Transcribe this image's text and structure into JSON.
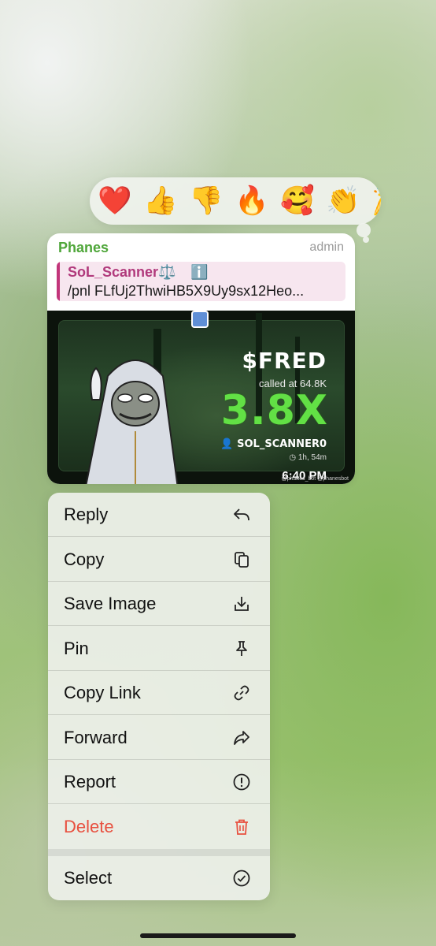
{
  "reactions": [
    "❤️",
    "👍",
    "👎",
    "🔥",
    "🥰",
    "👏",
    "🎉"
  ],
  "message": {
    "sender": "Phanes",
    "role": "admin",
    "quote": {
      "name": "SoL_Scanner⚖️",
      "name_icon": "ℹ️",
      "text": "/pnl FLfUj2ThwiHB5X9Uy9sx12Heo..."
    },
    "card": {
      "ticker": "$FRED",
      "called_at": "called at 64.8K",
      "multiple": "3.8X",
      "caller": "SOL_SCANNER0",
      "duration": "1h, 54m",
      "time": "6:40 PM",
      "handles": "@phanes_bot   @phanesbot"
    }
  },
  "menu": {
    "items": [
      {
        "label": "Reply",
        "icon": "reply-icon"
      },
      {
        "label": "Copy",
        "icon": "copy-icon"
      },
      {
        "label": "Save Image",
        "icon": "save-image-icon"
      },
      {
        "label": "Pin",
        "icon": "pin-icon"
      },
      {
        "label": "Copy Link",
        "icon": "link-icon"
      },
      {
        "label": "Forward",
        "icon": "forward-icon"
      },
      {
        "label": "Report",
        "icon": "report-icon"
      },
      {
        "label": "Delete",
        "icon": "trash-icon"
      },
      {
        "label": "Select",
        "icon": "select-check-icon"
      }
    ]
  },
  "colors": {
    "sender": "#4fa63a",
    "quote_accent": "#c2357a",
    "danger": "#e8503f",
    "multiple": "#62e045"
  }
}
